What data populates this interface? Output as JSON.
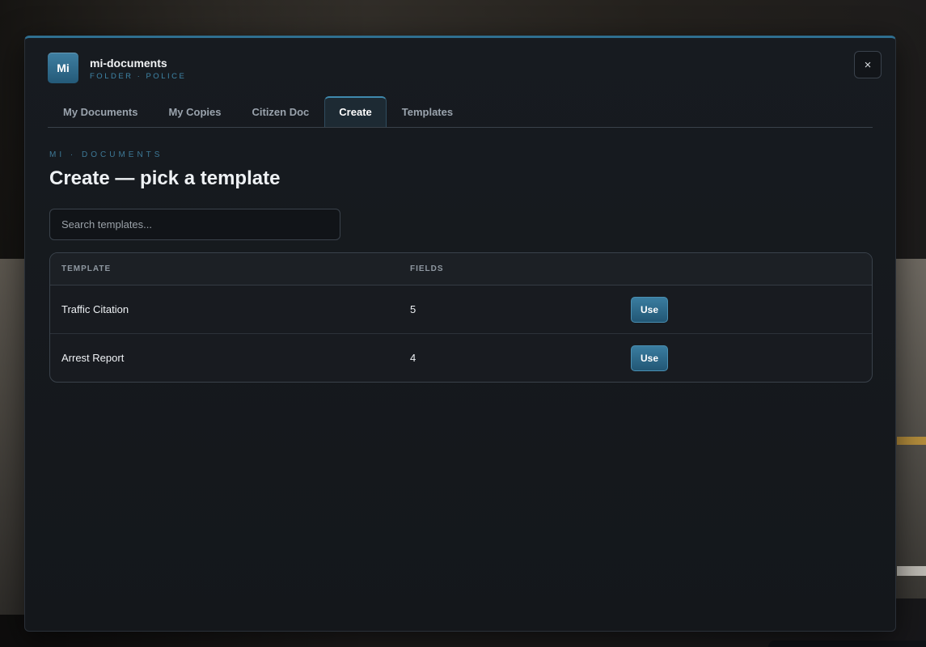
{
  "app": {
    "icon_text": "Mi",
    "title": "mi-documents",
    "subtitle": "FOLDER · POLICE",
    "close_label": "×"
  },
  "tabs": [
    {
      "label": "My Documents",
      "active": false
    },
    {
      "label": "My Copies",
      "active": false
    },
    {
      "label": "Citizen Doc",
      "active": false
    },
    {
      "label": "Create",
      "active": true
    },
    {
      "label": "Templates",
      "active": false
    }
  ],
  "main": {
    "kicker": "MI · DOCUMENTS",
    "title": "Create — pick a template",
    "search_placeholder": "Search templates..."
  },
  "table": {
    "headers": [
      "TEMPLATE",
      "FIELDS",
      ""
    ],
    "rows": [
      {
        "template": "Traffic Citation",
        "fields": "5",
        "action": "Use"
      },
      {
        "template": "Arrest Report",
        "fields": "4",
        "action": "Use"
      }
    ]
  },
  "colors": {
    "accent": "#2f6f90",
    "button": "#2a6a8c"
  }
}
